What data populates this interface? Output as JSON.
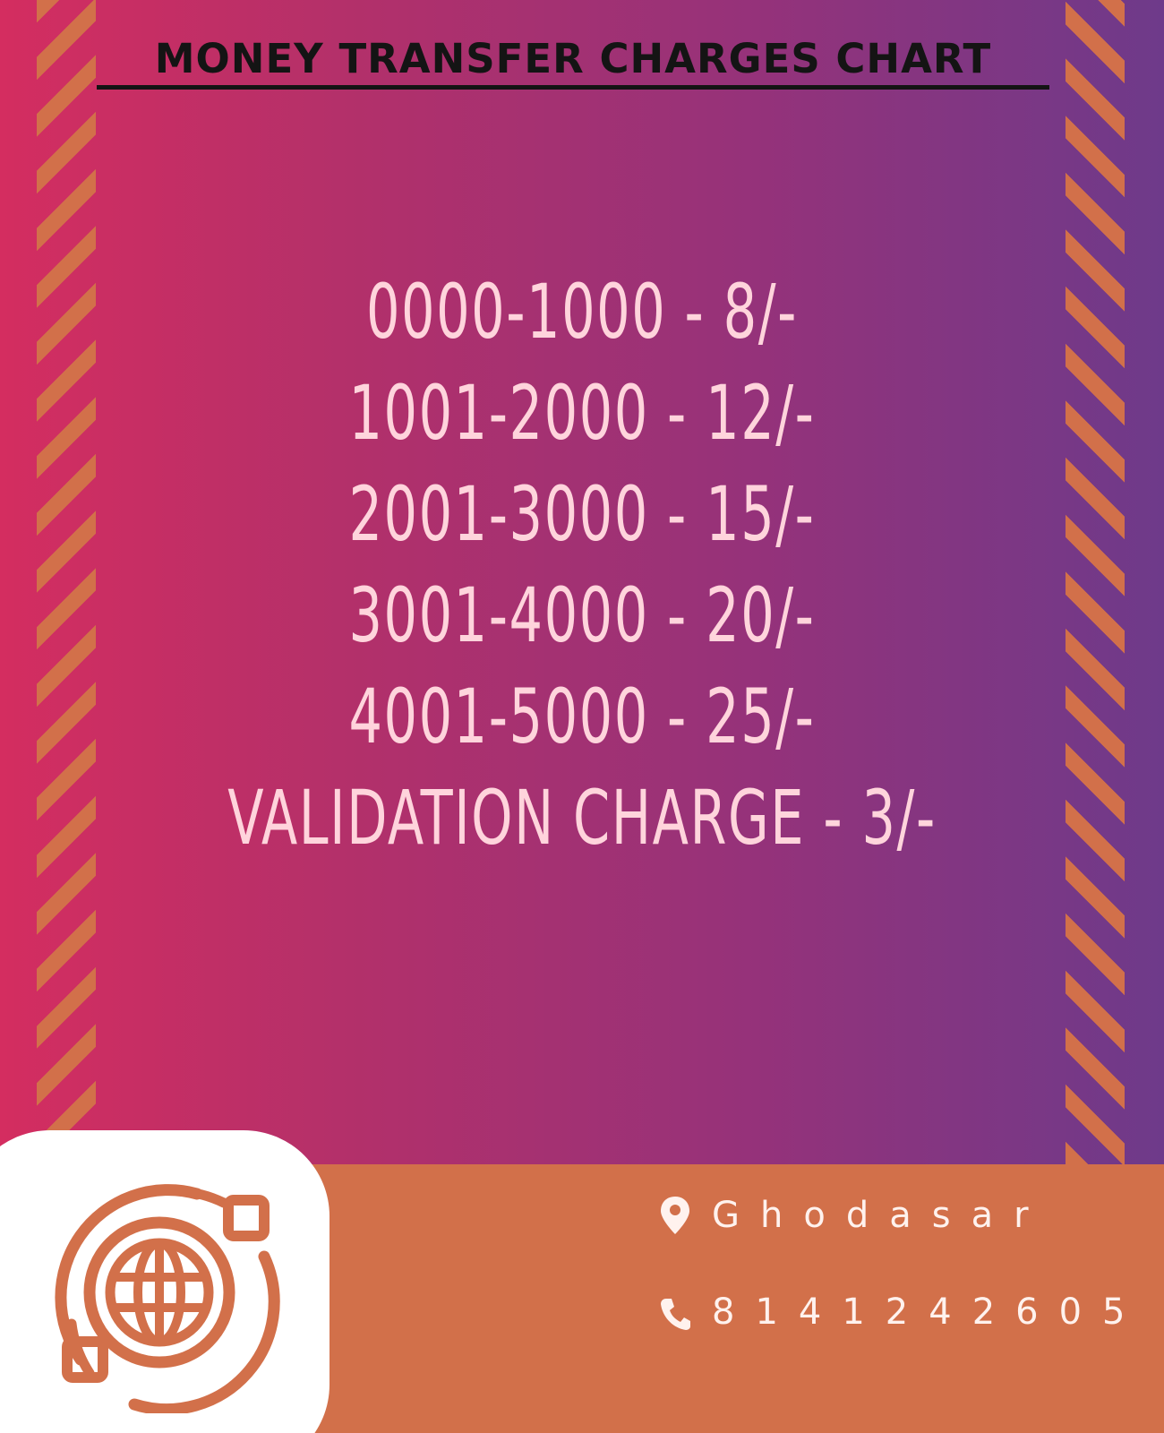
{
  "title": "MONEY TRANSFER CHARGES CHART",
  "rates": [
    "0000-1000 - 8/-",
    "1001-2000 - 12/-",
    "2001-3000 - 15/-",
    "3001-4000 - 20/-",
    "4001-5000 - 25/-",
    "VALIDATION CHARGE - 3/-"
  ],
  "contact": {
    "place": "Ghodasar",
    "phone": "8141242605",
    "place_icon": "location-pin-icon",
    "phone_icon": "phone-icon"
  },
  "logo_icon": "globe-transfer-icon",
  "colors": {
    "background_start": "#d42d60",
    "background_end": "#6e3a8a",
    "stripe": "#d2704a",
    "footer": "#d2704a",
    "rate_text": "#ffd4dc",
    "title_text": "#141414"
  }
}
